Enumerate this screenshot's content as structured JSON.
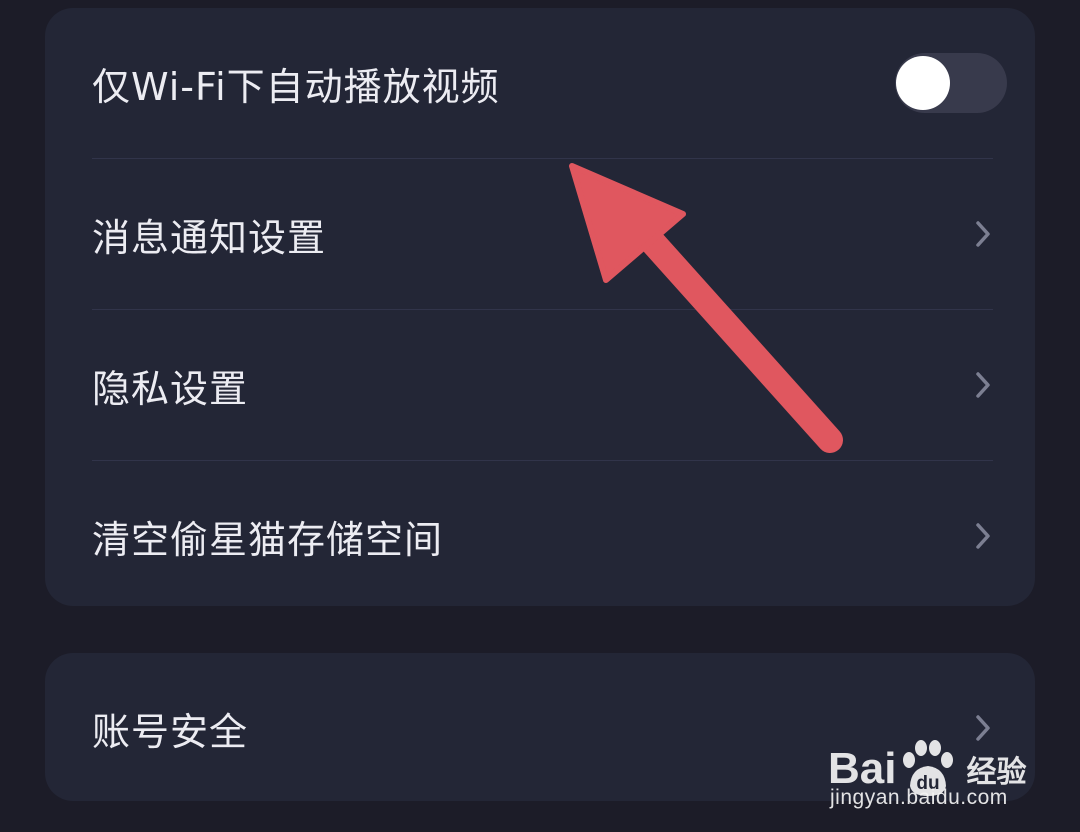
{
  "settings_group_1": {
    "items": [
      {
        "label": "仅Wi-Fi下自动播放视频",
        "control": "toggle",
        "toggle_on": false
      },
      {
        "label": "消息通知设置",
        "control": "chevron-right-icon"
      },
      {
        "label": "隐私设置",
        "control": "chevron-right-icon"
      },
      {
        "label": "清空偷星猫存储空间",
        "control": "chevron-right-icon"
      }
    ]
  },
  "settings_group_2": {
    "items": [
      {
        "label": "账号安全",
        "control": "chevron-right-icon"
      }
    ]
  },
  "annotation": {
    "icon": "arrow-icon",
    "color": "#e0575f"
  },
  "watermark": {
    "brand_bai": "Bai",
    "brand_du": "du",
    "brand_cn": "经验",
    "url": "jingyan.baidu.com"
  },
  "colors": {
    "background": "#1c1c28",
    "card": "#232636",
    "text": "#ececf2",
    "toggle_track": "#383a4c",
    "toggle_knob": "#ffffff",
    "chevron": "#7c7f92"
  }
}
